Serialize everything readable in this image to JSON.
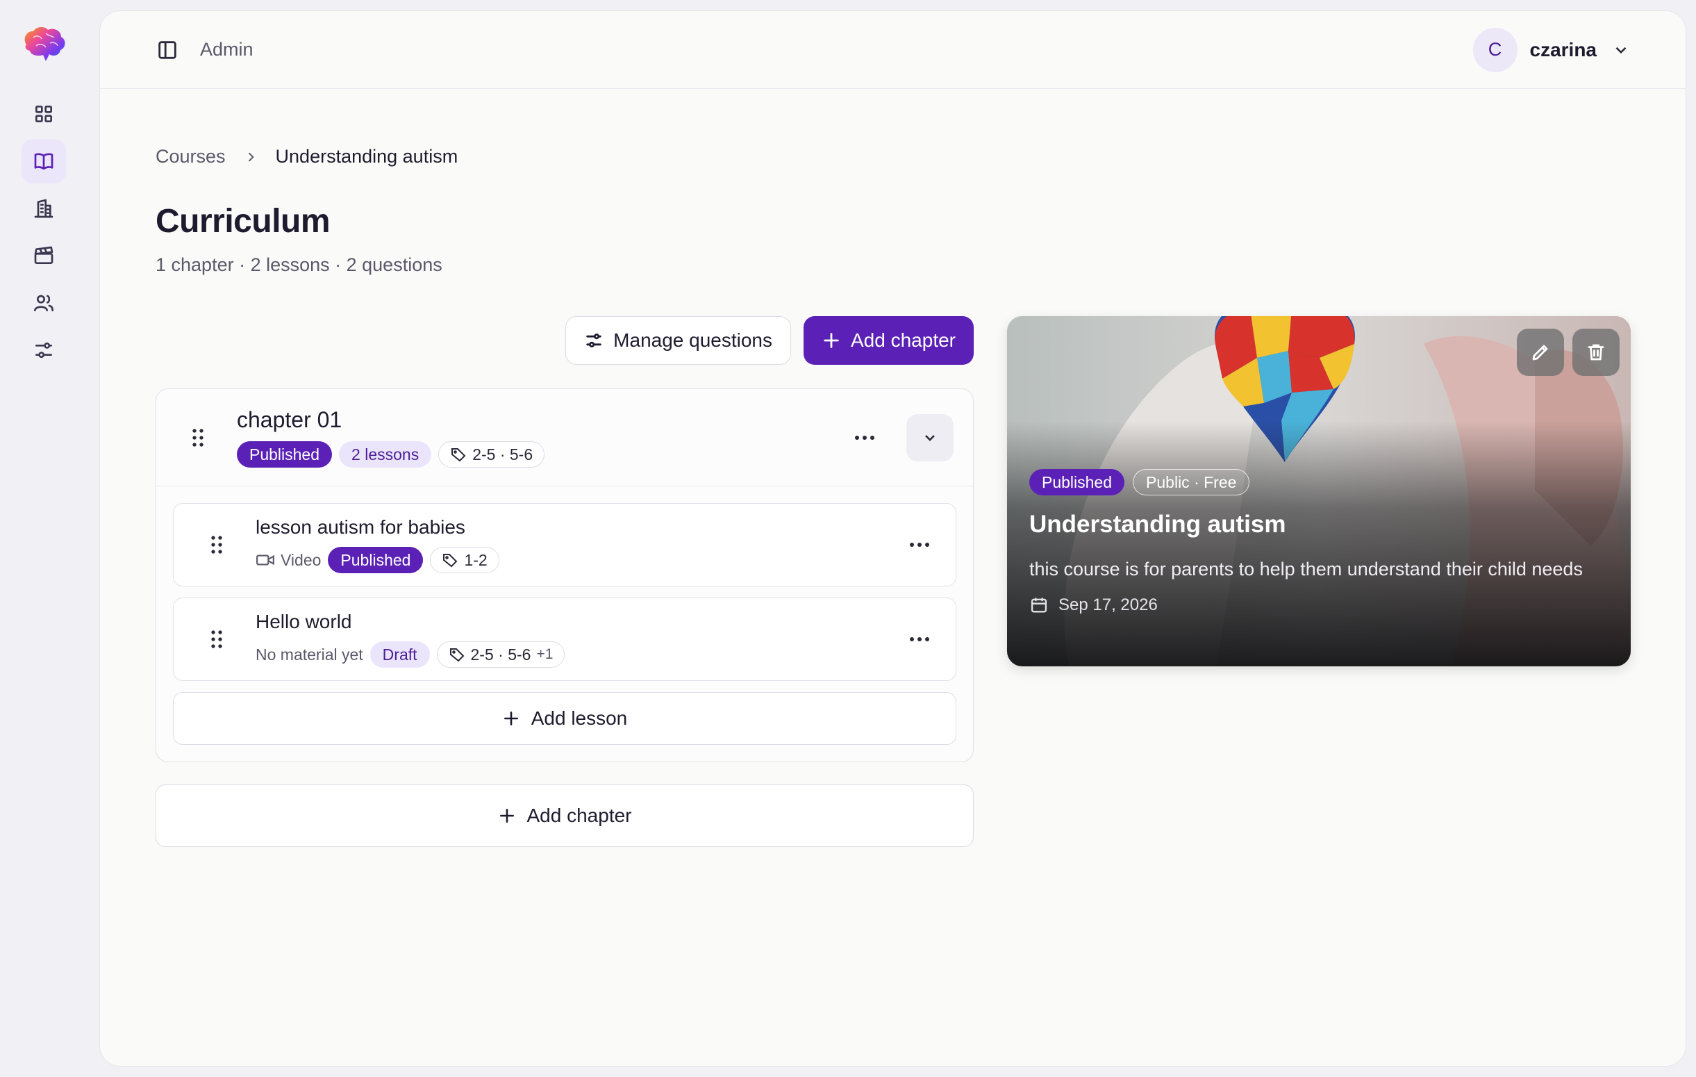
{
  "header": {
    "section": "Admin"
  },
  "user": {
    "initial": "C",
    "name": "czarina"
  },
  "sidebar": {
    "items": [
      {
        "icon": "grid-icon",
        "active": false
      },
      {
        "icon": "book-icon",
        "active": true
      },
      {
        "icon": "building-icon",
        "active": false
      },
      {
        "icon": "clapperboard-icon",
        "active": false
      },
      {
        "icon": "users-icon",
        "active": false
      },
      {
        "icon": "sliders-icon",
        "active": false
      }
    ]
  },
  "breadcrumb": {
    "parent": "Courses",
    "current": "Understanding autism"
  },
  "page": {
    "title": "Curriculum",
    "summary": "1 chapter · 2 lessons · 2 questions"
  },
  "actions": {
    "manage_questions": "Manage questions",
    "add_chapter": "Add chapter"
  },
  "chapter": {
    "name": "chapter 01",
    "status": "Published",
    "lesson_count": "2 lessons",
    "age_tag": "2-5 · 5-6"
  },
  "lessons": [
    {
      "name": "lesson autism for babies",
      "material": "Video",
      "status": "Published",
      "age_tag": "1-2",
      "extra": ""
    },
    {
      "name": "Hello world",
      "material": "No material yet",
      "status": "Draft",
      "age_tag": "2-5 · 5-6",
      "extra": "+1"
    }
  ],
  "add_lesson_label": "Add lesson",
  "add_chapter_bottom_label": "Add chapter",
  "course_card": {
    "status": "Published",
    "visibility": "Public · Free",
    "title": "Understanding autism",
    "description": "this course is for parents to help them understand their child needs",
    "date": "Sep 17, 2026"
  },
  "colors": {
    "accent": "#5b21b6",
    "accent_soft": "#ebe5fb"
  }
}
